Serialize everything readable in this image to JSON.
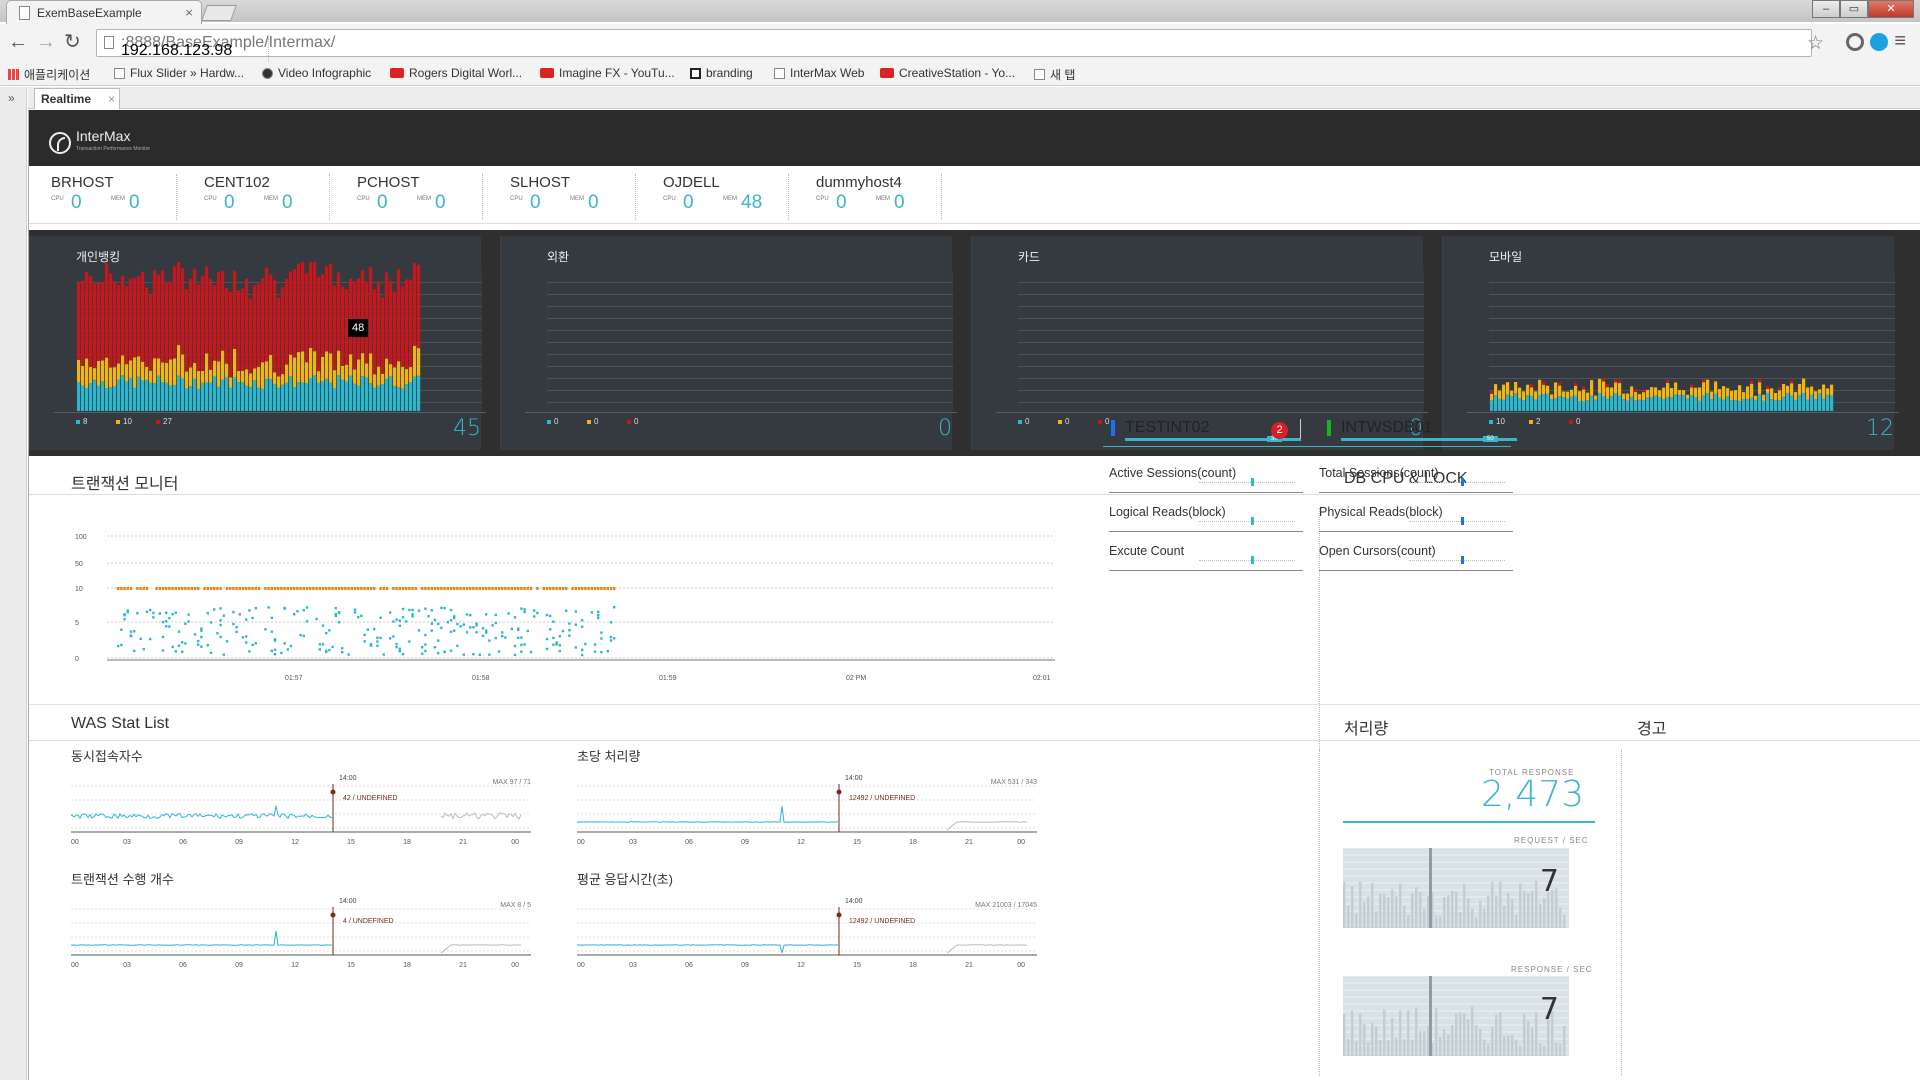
{
  "browser": {
    "tab_title": "ExemBaseExample",
    "url_host": "192.168.123.98",
    "url_rest": ":8888/BaseExample/Intermax/",
    "bookmarks": [
      "애플리케이션",
      "Flux Slider » Hardw...",
      "Video Infographic",
      "Rogers Digital Worl...",
      "Imagine FX - YouTu...",
      "branding",
      "InterMax Web",
      "CreativeStation - Yo...",
      "새 탭"
    ]
  },
  "app": {
    "tab_label": "Realtime",
    "logo_text": "InterMax",
    "logo_sub": "Transaction Performance Monitor",
    "hosts": [
      {
        "name": "BRHOST",
        "cpu_label": "CPU",
        "cpu": "0",
        "mem_label": "MEM",
        "mem": "0"
      },
      {
        "name": "CENT102",
        "cpu_label": "CPU",
        "cpu": "0",
        "mem_label": "MEM",
        "mem": "0"
      },
      {
        "name": "PCHOST",
        "cpu_label": "CPU",
        "cpu": "0",
        "mem_label": "MEM",
        "mem": "0"
      },
      {
        "name": "SLHOST",
        "cpu_label": "CPU",
        "cpu": "0",
        "mem_label": "MEM",
        "mem": "0"
      },
      {
        "name": "OJDELL",
        "cpu_label": "CPU",
        "cpu": "0",
        "mem_label": "MEM",
        "mem": "48"
      },
      {
        "name": "dummyhost4",
        "cpu_label": "CPU",
        "cpu": "0",
        "mem_label": "MEM",
        "mem": "0"
      }
    ],
    "business_panels": [
      {
        "title": "개인뱅킹",
        "legend": [
          "8",
          "10",
          "27"
        ],
        "value": "45",
        "tooltip": "48"
      },
      {
        "title": "외환",
        "legend": [
          "0",
          "0",
          "0"
        ],
        "value": "0"
      },
      {
        "title": "카드",
        "legend": [
          "0",
          "0",
          "0"
        ],
        "value": "0"
      },
      {
        "title": "모바일",
        "legend": [
          "10",
          "2",
          "0"
        ],
        "value": "12"
      }
    ],
    "legend_colors": [
      "#2bb7d0",
      "#f2b40e",
      "#c8161c"
    ],
    "tx_monitor": {
      "title": "트랜잭션 모니터",
      "y_ticks": [
        "100",
        "50",
        "10",
        "5",
        "0"
      ],
      "x_ticks": [
        "01:57",
        "01:58",
        "01:59",
        "02 PM",
        "02:01"
      ]
    },
    "db": {
      "title": "DB CPU & LOCK",
      "instances": [
        {
          "name": "TESTINT02",
          "bar_value": "30",
          "color": "#1a73e8",
          "lock_count": "2"
        },
        {
          "name": "INTWSDB01",
          "bar_value": "50",
          "color": "#16b71a"
        }
      ],
      "metrics_left": [
        "Active Sessions(count)",
        "Logical Reads(block)",
        "Excute Count"
      ],
      "metrics_right": [
        "Total Sessions(count)",
        "Physical Reads(block)",
        "Open Cursors(count)"
      ]
    },
    "was_stat": {
      "title": "WAS Stat List",
      "x_ticks": [
        "00",
        "03",
        "06",
        "09",
        "12",
        "15",
        "18",
        "21",
        "00"
      ],
      "charts": [
        {
          "title": "동시접속자수",
          "max_text": "MAX 97 / 71",
          "time": "14:00",
          "value_text": "42 / UNDEFINED"
        },
        {
          "title": "초당 처리량",
          "max_text": "MAX 531 / 343",
          "time": "14:00",
          "value_text": "12492 / UNDEFINED"
        },
        {
          "title": "트랜잭션 수행 개수",
          "max_text": "MAX 8 / 5",
          "time": "14:00",
          "value_text": "4 / UNDEFINED"
        },
        {
          "title": "평균 응답시간(초)",
          "max_text": "MAX 21003 / 17045",
          "time": "14:00",
          "value_text": "12492 / UNDEFINED"
        }
      ]
    },
    "throughput": {
      "title": "처리량",
      "total_label": "TOTAL RESPONSE",
      "total": "2,473",
      "req_label": "REQUEST / SEC",
      "req": "7",
      "resp_label": "RESPONSE / SEC",
      "resp": "7"
    },
    "alert": {
      "title": "경고"
    }
  }
}
